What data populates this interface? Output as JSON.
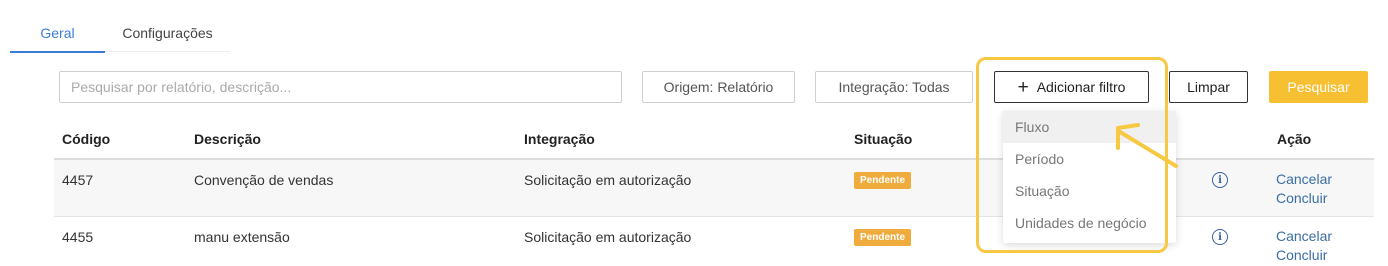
{
  "tabs": [
    {
      "label": "Geral",
      "active": true
    },
    {
      "label": "Configurações",
      "active": false
    }
  ],
  "toolbar": {
    "search_placeholder": "Pesquisar por relatório, descrição...",
    "origem_label": "Origem: Relatório",
    "integracao_label": "Integração: Todas",
    "add_filter_label": "Adicionar filtro",
    "clear_label": "Limpar",
    "search_label": "Pesquisar"
  },
  "table": {
    "headers": [
      "Código",
      "Descrição",
      "Integração",
      "Situação",
      "Ação"
    ],
    "rows": [
      {
        "codigo": "4457",
        "descricao": "Convenção de vendas",
        "integracao": "Solicitação em autorização",
        "situacao": "Pendente",
        "actions": [
          "Cancelar",
          "Concluir"
        ]
      },
      {
        "codigo": "4455",
        "descricao": "manu extensão",
        "integracao": "Solicitação em autorização",
        "situacao": "Pendente",
        "actions": [
          "Cancelar",
          "Concluir"
        ]
      }
    ]
  },
  "filter_menu": {
    "items": [
      "Fluxo",
      "Período",
      "Situação",
      "Unidades de negócio"
    ]
  },
  "colors": {
    "accent": "#3b7dd8",
    "primary_button": "#f7bf32",
    "badge_pending": "#efab3c",
    "highlight": "#f7c843",
    "link": "#3a6ea5"
  },
  "icons": [
    "plus-icon",
    "info-icon",
    "annotation-arrow-icon"
  ]
}
